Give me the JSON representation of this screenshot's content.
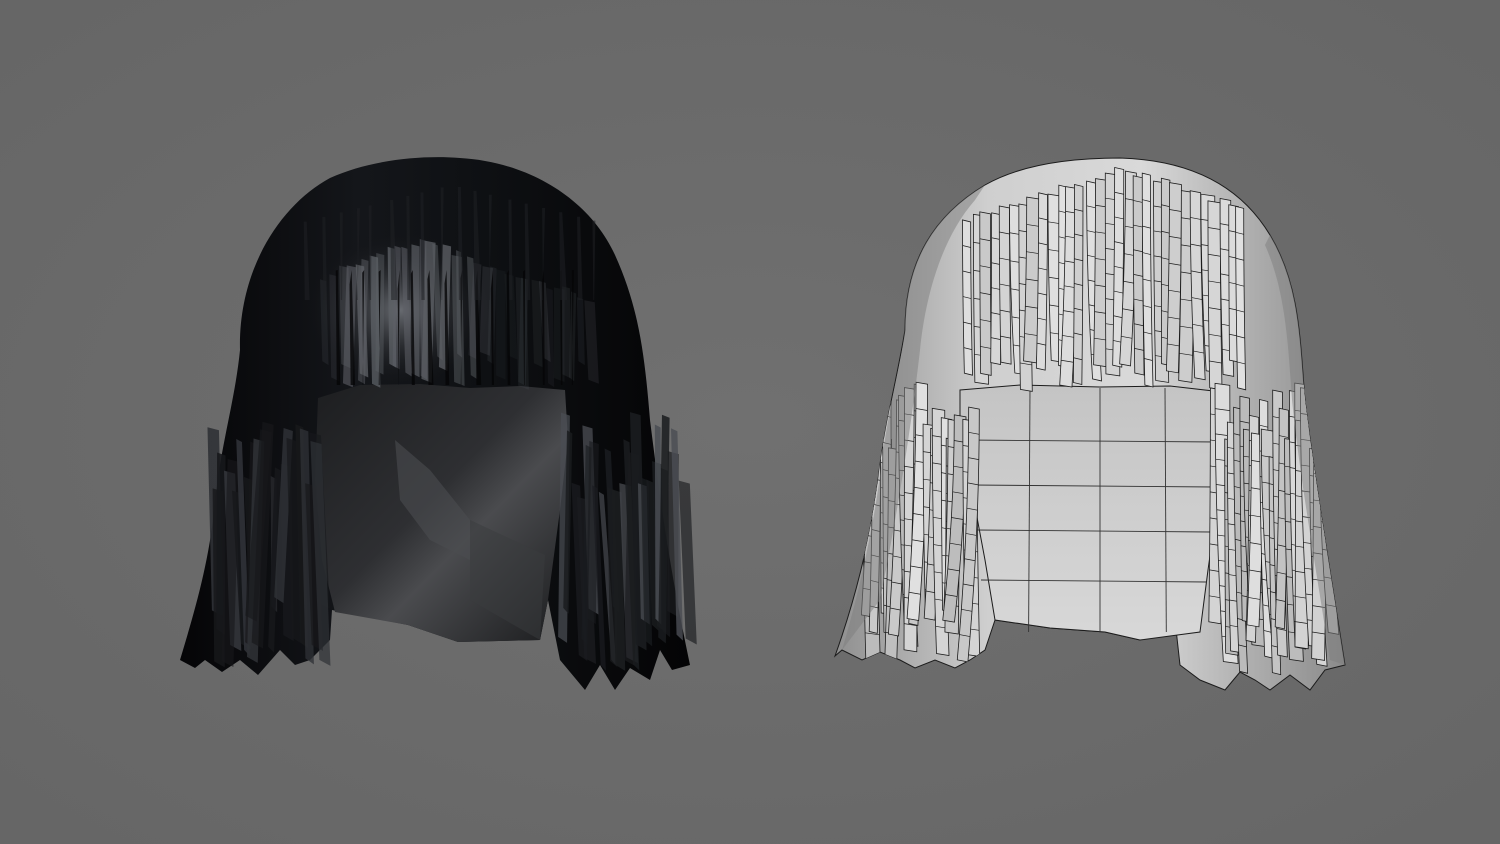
{
  "scene": {
    "background_color": "#6b6b6b",
    "models": [
      {
        "id": "shaded-hair",
        "render_mode": "shaded",
        "base_color": "#0d0e11",
        "highlight_color": "#5a5d63",
        "face_color": "#26272a"
      },
      {
        "id": "wireframe-hair",
        "render_mode": "wireframe",
        "base_color": "#d6d6d6",
        "shadow_color": "#9a9a9a",
        "wire_color": "#1c1c1c",
        "face_color": "#c9c9c9"
      }
    ]
  }
}
